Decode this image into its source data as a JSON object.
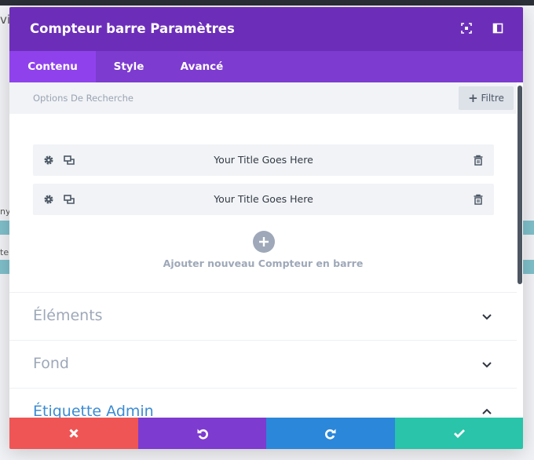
{
  "background": {
    "fragments": [
      "vi",
      "ny",
      "te"
    ]
  },
  "modal": {
    "title": "Compteur barre Paramètres",
    "header_icons": [
      "expand-icon",
      "sidebar-toggle-icon"
    ],
    "colors": {
      "header": "#6c2eb9",
      "tabs": "#7d3bd0",
      "active_tab": "#8f42ec",
      "cancel": "#ef5555",
      "undo": "#7e3bd0",
      "redo": "#2b87da",
      "save": "#29c4a9"
    }
  },
  "tabs": [
    {
      "label": "Contenu",
      "active": true
    },
    {
      "label": "Style",
      "active": false
    },
    {
      "label": "Avancé",
      "active": false
    }
  ],
  "search": {
    "label": "Options De Recherche",
    "filter_label": "Filtre"
  },
  "items": [
    {
      "title": "Your Title Goes Here"
    },
    {
      "title": "Your Title Goes Here"
    }
  ],
  "add_item": {
    "label": "Ajouter nouveau Compteur en barre"
  },
  "sections": [
    {
      "title": "Éléments",
      "expanded": false
    },
    {
      "title": "Fond",
      "expanded": false
    },
    {
      "title": "Étiquette Admin",
      "expanded": true
    }
  ],
  "footer": {
    "buttons": [
      "cancel-icon",
      "undo-icon",
      "redo-icon",
      "check-icon"
    ]
  }
}
